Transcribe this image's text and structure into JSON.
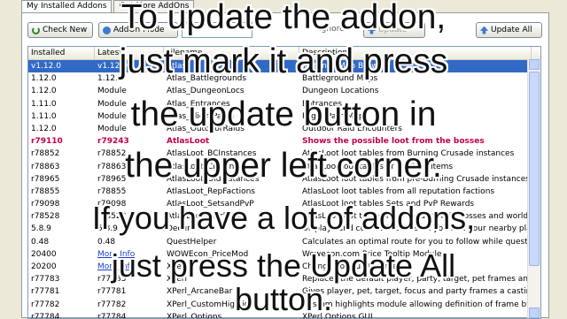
{
  "tabs": [
    "My Installed Addons",
    "Get More AddOns"
  ],
  "toolbar": {
    "check_new": "Check New",
    "addon_mode": "AddOn Mode",
    "ignore": "Ignore",
    "update": "Update",
    "update_all": "Update All"
  },
  "columns": [
    "Installed",
    "Latest",
    "Filename",
    "Description"
  ],
  "rows": [
    {
      "installed": "v1.12.0",
      "latest": "v1.12.0",
      "filename": "Atlas",
      "description": "Instance Map Browser",
      "style": "sel"
    },
    {
      "installed": "1.12.0",
      "latest": "1.12.0",
      "filename": "Atlas_Battlegrounds",
      "description": "Battleground Maps",
      "style": ""
    },
    {
      "installed": "1.12.0",
      "latest": "Module",
      "filename": "Atlas_DungeonLocs",
      "description": "Dungeon Locations",
      "style": ""
    },
    {
      "installed": "1.11.0",
      "latest": "Module",
      "filename": "Atlas_Entrances",
      "description": "Entrances",
      "style": ""
    },
    {
      "installed": "1.11.0",
      "latest": "Module",
      "filename": "Atlas_FlightPaths",
      "description": "Flight Path Maps",
      "style": ""
    },
    {
      "installed": "1.12.0",
      "latest": "Module",
      "filename": "Atlas_OutdoorRaids",
      "description": "Outdoor Raid Encounters",
      "style": ""
    },
    {
      "installed": "r79110",
      "latest": "r79243",
      "filename": "AtlasLoot",
      "description": "Shows the possible loot from the bosses",
      "style": "red"
    },
    {
      "installed": "r78852",
      "latest": "r78852",
      "filename": "AtlasLoot_BCInstances",
      "description": "AtlasLoot loot tables from Burning Crusade instances",
      "style": ""
    },
    {
      "installed": "r78863",
      "latest": "r78863",
      "filename": "AtlasLoot_Crafting",
      "description": "AtlasLoot loot tables of Crafting items",
      "style": ""
    },
    {
      "installed": "r78965",
      "latest": "r78965",
      "filename": "AtlasLoot_OldInstances",
      "description": "AtlasLoot loot tables from pre-Burning Crusade instances",
      "style": ""
    },
    {
      "installed": "r78855",
      "latest": "r78855",
      "filename": "AtlasLoot_RepFactions",
      "description": "AtlasLoot loot tables from all reputation factions",
      "style": ""
    },
    {
      "installed": "r79098",
      "latest": "r79098",
      "filename": "AtlasLoot_SetsandPvP",
      "description": "AtlasLoot loot tables Sets and PvP Rewards",
      "style": ""
    },
    {
      "installed": "r78528",
      "latest": "r78528",
      "filename": "AtlasLoot_WorldLoot",
      "description": "AtlasLoot loot tables from outdoor raid bosses and world events",
      "style": ""
    },
    {
      "installed": "5.8.9",
      "latest": "5.8.9",
      "filename": "Decursive",
      "description": "Displays and cures afflictions on you and your nearby players",
      "style": ""
    },
    {
      "installed": "0.48",
      "latest": "0.48",
      "filename": "QuestHelper",
      "description": "Calculates an optimal route for you to follow while questing",
      "style": ""
    },
    {
      "installed": "20400",
      "latest": "More Info",
      "filename": "WOWEcon_PriceMod",
      "description": "Wowecon.com Price Tooltip Module",
      "style": "link"
    },
    {
      "installed": "20200",
      "latest": "More Info",
      "filename": "XPerl",
      "description": "Change your unit frames",
      "style": "link"
    },
    {
      "installed": "r77783",
      "latest": "r77783",
      "filename": "XPerl",
      "description": "Replaces the default player, party, target, pet frames and adds",
      "style": ""
    },
    {
      "installed": "r77781",
      "latest": "r77781",
      "filename": "XPerl_ArcaneBar",
      "description": "Gives player, pet, target, focus and party frames a casting bar",
      "style": ""
    },
    {
      "installed": "r77782",
      "latest": "r77782",
      "filename": "XPerl_CustomHighlight",
      "description": "Custom highlights module allowing definition of frame by frame",
      "style": ""
    },
    {
      "installed": "r77784",
      "latest": "r77784",
      "filename": "XPerl_Options",
      "description": "XPerl Options GUI",
      "style": ""
    }
  ],
  "overlay": [
    "To update the addon,",
    "just mark it and press",
    "the update button in",
    "the upper left corner.",
    "If you have a lot of addons,",
    "just press the Update All",
    "button."
  ]
}
